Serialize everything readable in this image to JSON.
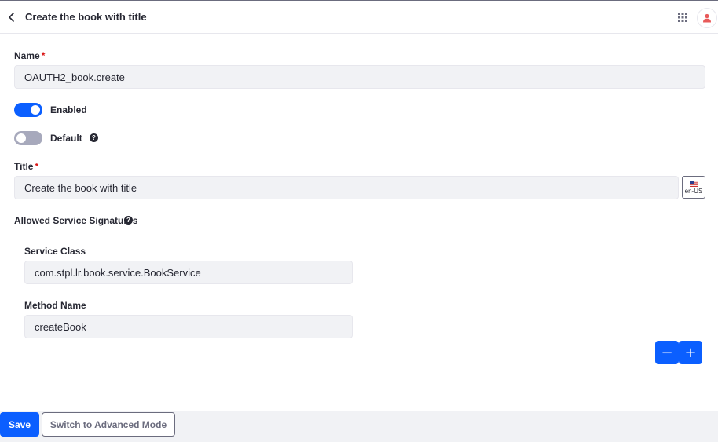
{
  "header": {
    "title": "Create the book with title",
    "back_icon": "chevron-left-icon",
    "apps_icon": "grid-icon",
    "user_icon": "user-icon"
  },
  "form": {
    "name": {
      "label": "Name",
      "required": "*",
      "value": "OAUTH2_book.create"
    },
    "enabled": {
      "label": "Enabled",
      "state": true
    },
    "default": {
      "label": "Default",
      "state": false,
      "help": "?"
    },
    "title": {
      "label": "Title",
      "required": "*",
      "value": "Create the book with title",
      "locale": "en-US"
    },
    "signatures": {
      "label": "Allowed Service Signatures",
      "help": "?",
      "service_class": {
        "label": "Service Class",
        "value": "com.stpl.lr.book.service.BookService"
      },
      "method_name": {
        "label": "Method Name",
        "value": "createBook"
      },
      "remove_label": "−",
      "add_label": "+"
    }
  },
  "footer": {
    "save_label": "Save",
    "advanced_label": "Switch to Advanced Mode"
  },
  "colors": {
    "primary": "#0b5fff",
    "required": "#da1414",
    "input_bg": "#f1f2f5",
    "avatar": "#e85a5a"
  }
}
